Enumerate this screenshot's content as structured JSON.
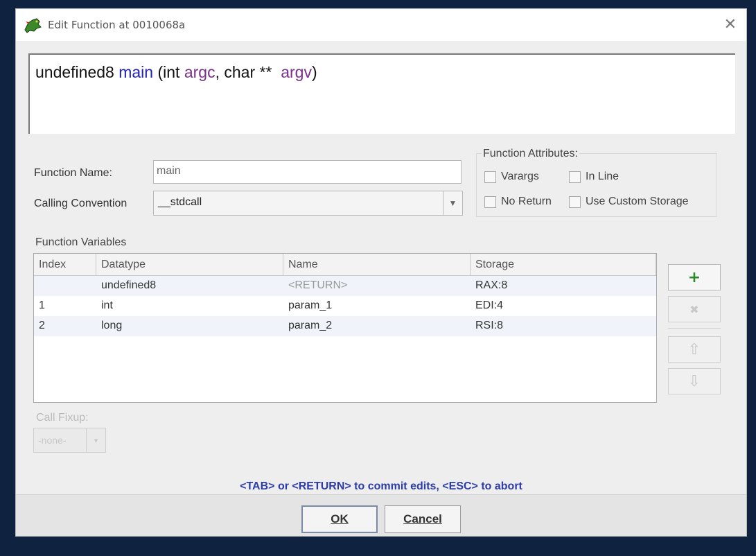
{
  "window": {
    "title": "Edit Function at 0010068a",
    "close_glyph": "✕"
  },
  "signature": {
    "return_type": "undefined8",
    "function_name": "main",
    "open": "(",
    "p1_type": "int",
    "p1_name": "argc",
    "sep": ", ",
    "p2_type": "char **",
    "p2_name": "argv",
    "close": ")"
  },
  "form": {
    "function_name_label": "Function Name:",
    "function_name_value": "main",
    "calling_convention_label": "Calling Convention",
    "calling_convention_value": "__stdcall"
  },
  "attributes": {
    "title": "Function Attributes:",
    "varargs": "Varargs",
    "inline": "In Line",
    "no_return": "No Return",
    "custom_storage": "Use Custom Storage"
  },
  "variables": {
    "title": "Function Variables",
    "columns": [
      "Index",
      "Datatype",
      "Name",
      "Storage"
    ],
    "rows": [
      {
        "index": "",
        "datatype": "undefined8",
        "name": "<RETURN>",
        "storage": "RAX:8"
      },
      {
        "index": "1",
        "datatype": "int",
        "name": "param_1",
        "storage": "EDI:4"
      },
      {
        "index": "2",
        "datatype": "long",
        "name": "param_2",
        "storage": "RSI:8"
      }
    ]
  },
  "side_buttons": {
    "add": "+",
    "remove": "✖",
    "up": "⇧",
    "down": "⇩"
  },
  "fixup": {
    "label": "Call Fixup:",
    "value": "-none-",
    "arrow": "▾"
  },
  "hint": "<TAB> or <RETURN> to commit edits, <ESC> to abort",
  "buttons": {
    "ok": "OK",
    "cancel": "Cancel"
  },
  "colors": {
    "function_name": "#2222bb",
    "param_name": "#7a2f8a",
    "hint": "#2c3ca8",
    "add_icon": "#2a8a2a"
  }
}
